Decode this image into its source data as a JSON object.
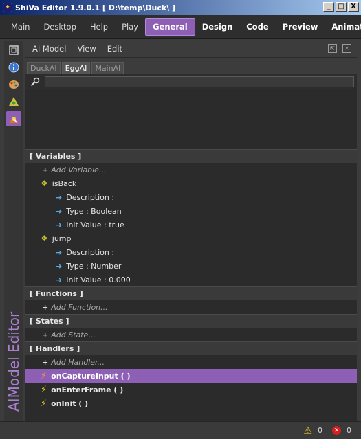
{
  "window": {
    "title": "ShiVa Editor 1.9.0.1 [ D:\\temp\\Duck\\ ]",
    "controls": {
      "minimize": "_",
      "maximize": "□",
      "close": "X"
    }
  },
  "menubar": {
    "items": [
      {
        "label": "Main",
        "style": "normal"
      },
      {
        "label": "Desktop",
        "style": "normal"
      },
      {
        "label": "Help",
        "style": "normal"
      },
      {
        "label": "Play",
        "style": "normal"
      },
      {
        "label": "General",
        "style": "active"
      },
      {
        "label": "Design",
        "style": "bold"
      },
      {
        "label": "Code",
        "style": "bold"
      },
      {
        "label": "Preview",
        "style": "bold"
      },
      {
        "label": "Animation",
        "style": "bold"
      }
    ]
  },
  "sidebar": {
    "icons": [
      "info-icon",
      "palette-icon",
      "scene-icon",
      "aimodel-icon"
    ],
    "active_index": 3,
    "vertical_title": "AIModel Editor"
  },
  "panel": {
    "menu": [
      "AI Model",
      "View",
      "Edit"
    ],
    "tabs": [
      {
        "label": "DuckAI",
        "active": false
      },
      {
        "label": "EggAI",
        "active": true
      },
      {
        "label": "MainAI",
        "active": false
      }
    ],
    "search": {
      "value": "",
      "placeholder": ""
    }
  },
  "tree": {
    "variables": {
      "header": "[ Variables ]",
      "add_label": "Add Variable...",
      "items": [
        {
          "name": "isBack",
          "description": "Description :",
          "type": "Type : Boolean",
          "init": "Init Value : true"
        },
        {
          "name": "jump",
          "description": "Description :",
          "type": "Type : Number",
          "init": "Init Value : 0.000"
        }
      ]
    },
    "functions": {
      "header": "[ Functions ]",
      "add_label": "Add Function..."
    },
    "states": {
      "header": "[ States ]",
      "add_label": "Add State..."
    },
    "handlers": {
      "header": "[ Handlers ]",
      "add_label": "Add Handler...",
      "items": [
        {
          "name": "onCaptureInput ( )",
          "selected": true
        },
        {
          "name": "onEnterFrame ( )",
          "selected": false
        },
        {
          "name": "onInit ( )",
          "selected": false
        }
      ]
    }
  },
  "statusbar": {
    "warnings": "0",
    "errors": "0"
  }
}
